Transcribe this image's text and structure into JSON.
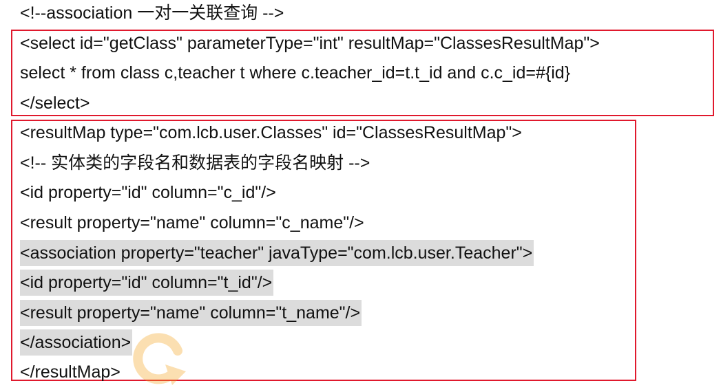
{
  "comment_line": "<!--association 一对一关联查询 -->",
  "select_block": {
    "lines": [
      "<select id=\"getClass\" parameterType=\"int\" resultMap=\"ClassesResultMap\">",
      "select * from class c,teacher t where c.teacher_id=t.t_id and c.c_id=#{id}",
      "</select>"
    ]
  },
  "resultmap_block": {
    "lines": [
      "<resultMap type=\"com.lcb.user.Classes\" id=\"ClassesResultMap\">",
      "<!-- 实体类的字段名和数据表的字段名映射 -->",
      "<id property=\"id\" column=\"c_id\"/>",
      "<result property=\"name\" column=\"c_name\"/>",
      "<association property=\"teacher\" javaType=\"com.lcb.user.Teacher\">",
      "<id property=\"id\" column=\"t_id\"/>",
      "<result property=\"name\" column=\"t_name\"/>",
      "</association>",
      "</resultMap>"
    ],
    "highlight_color": "#dcdcdc"
  },
  "colors": {
    "box_border": "#e0192d",
    "text": "#111111",
    "watermark": "#f5a623"
  }
}
